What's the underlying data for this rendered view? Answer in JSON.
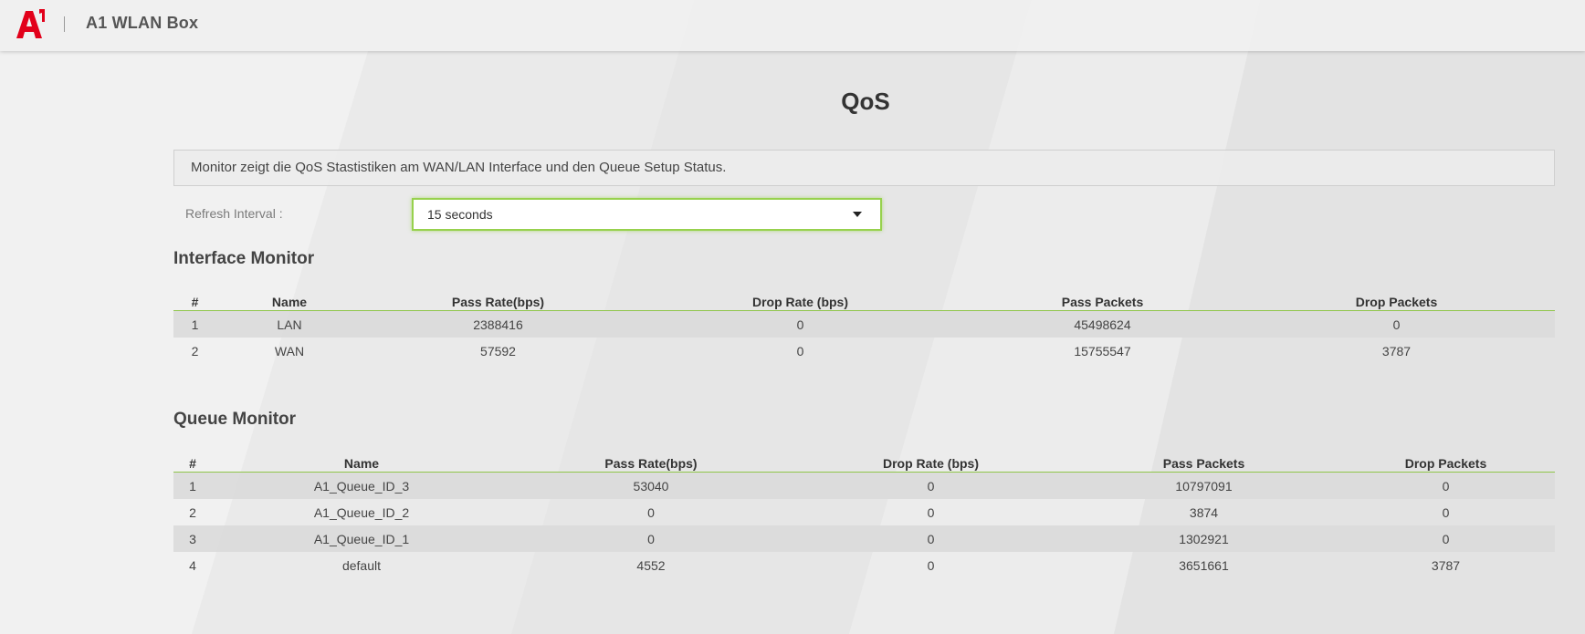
{
  "header": {
    "app_title": "A1 WLAN Box"
  },
  "page": {
    "title": "QoS",
    "description": "Monitor zeigt die QoS Stastistiken am WAN/LAN Interface und den Queue Setup Status."
  },
  "refresh": {
    "label": "Refresh Interval :",
    "selected": "15 seconds"
  },
  "colors": {
    "brand_red": "#e2001a",
    "accent_green": "#97d14d"
  },
  "interface_monitor": {
    "title": "Interface Monitor",
    "columns": [
      "#",
      "Name",
      "Pass Rate(bps)",
      "Drop Rate (bps)",
      "Pass Packets",
      "Drop Packets"
    ],
    "rows": [
      [
        "1",
        "LAN",
        "2388416",
        "0",
        "45498624",
        "0"
      ],
      [
        "2",
        "WAN",
        "57592",
        "0",
        "15755547",
        "3787"
      ]
    ]
  },
  "queue_monitor": {
    "title": "Queue Monitor",
    "columns": [
      "#",
      "Name",
      "Pass Rate(bps)",
      "Drop Rate (bps)",
      "Pass Packets",
      "Drop Packets"
    ],
    "rows": [
      [
        "1",
        "A1_Queue_ID_3",
        "53040",
        "0",
        "10797091",
        "0"
      ],
      [
        "2",
        "A1_Queue_ID_2",
        "0",
        "0",
        "3874",
        "0"
      ],
      [
        "3",
        "A1_Queue_ID_1",
        "0",
        "0",
        "1302921",
        "0"
      ],
      [
        "4",
        "default",
        "4552",
        "0",
        "3651661",
        "3787"
      ]
    ]
  }
}
